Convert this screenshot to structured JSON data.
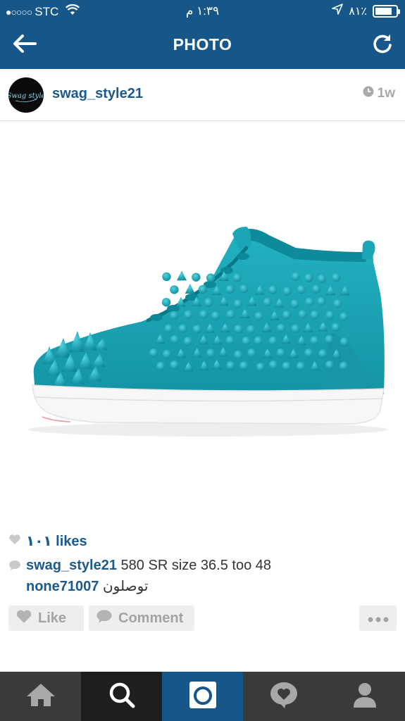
{
  "status_bar": {
    "signal": "●○○○○",
    "carrier": "STC",
    "time": "١:٣٩ م",
    "battery": "٨١٪",
    "battery_level": 0.81
  },
  "header": {
    "title": "PHOTO",
    "back_icon": "arrow-left-icon",
    "refresh_icon": "refresh-icon"
  },
  "post": {
    "username": "swag_style21",
    "avatar_text": "Swag style",
    "time_ago": "1w",
    "likes": "١٠١ likes",
    "caption_user": "swag_style21",
    "caption_text": "580 SR size 36.5 too 48",
    "comment_user": "none71007",
    "comment_text": "توصلون"
  },
  "actions": {
    "like_label": "Like",
    "comment_label": "Comment"
  },
  "tabs": [
    {
      "name": "home",
      "icon": "home-icon"
    },
    {
      "name": "search",
      "icon": "search-icon"
    },
    {
      "name": "camera",
      "icon": "camera-icon"
    },
    {
      "name": "activity",
      "icon": "heart-bubble-icon"
    },
    {
      "name": "profile",
      "icon": "person-icon"
    }
  ],
  "colors": {
    "brand_blue": "#175688",
    "link_blue": "#1b5a8a",
    "shoe_teal": "#1aa6b7",
    "tab_dark": "#3a3a3a"
  }
}
